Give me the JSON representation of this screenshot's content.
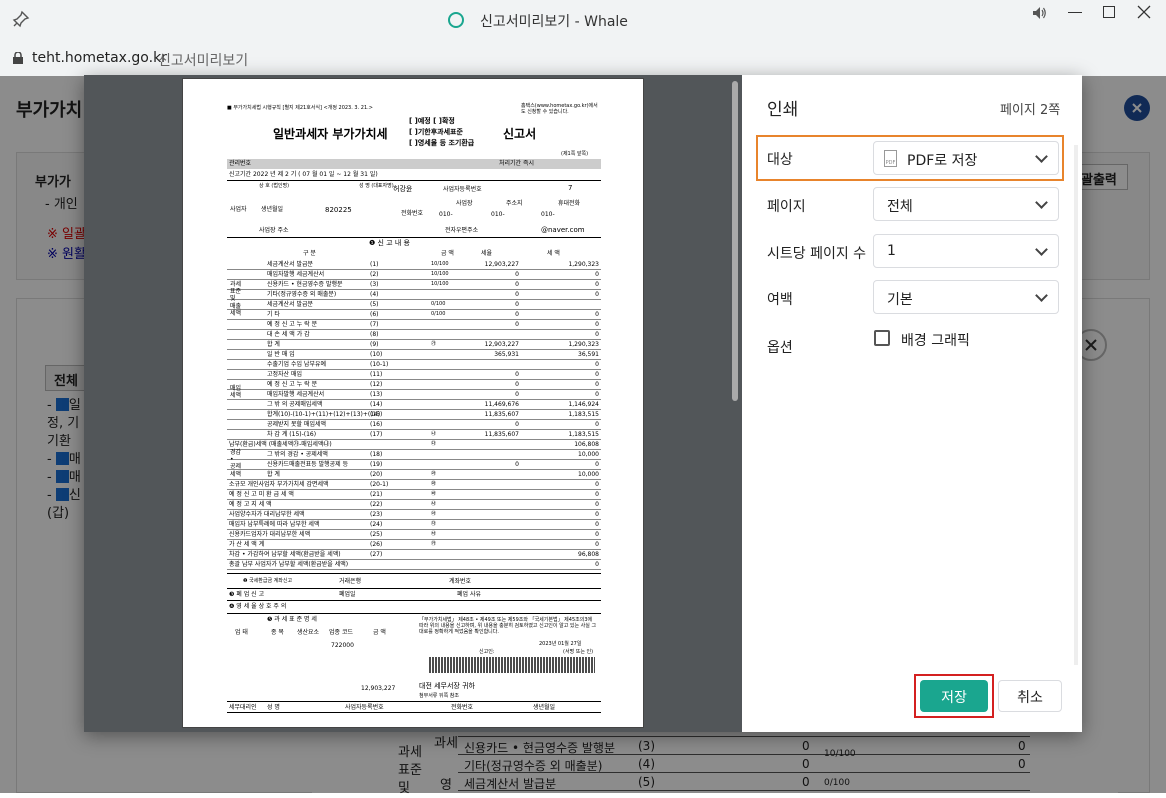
{
  "window": {
    "title": "신고서미리보기 - Whale",
    "url_host": "teht.hometax.go.kr",
    "url_title": "신고서미리보기"
  },
  "background": {
    "heading": "부가가치",
    "notice_title": "부가가",
    "notice_sub": "- 개인",
    "warn1": "※ 일괄",
    "warn2": "※ 원활",
    "print_btn": "괄출력",
    "all_btn": "전체",
    "tree": [
      "일",
      "정, 기",
      "기환",
      "매",
      "매",
      "신",
      "(갑)"
    ],
    "table": {
      "cat1": "과세",
      "cat2": "과세\n표준\n및",
      "cat3": "영",
      "rows": [
        {
          "label": "신용카드 • 현금영수증 발행분",
          "no": "(3)",
          "amount": "0",
          "tax": "0"
        },
        {
          "label": "기타(정규영수증 외 매출분)",
          "no": "(4)",
          "amount": "0",
          "rate": "10/100",
          "tax": "0"
        },
        {
          "label": "세금계산서 발급분",
          "no": "(5)",
          "amount": "0",
          "rate": "0/100",
          "tax": ""
        }
      ]
    }
  },
  "print_panel": {
    "title": "인쇄",
    "page_count": "페이지 2쪽",
    "destination_label": "대상",
    "destination_value": "PDF로 저장",
    "destination_icon_text": "PDF",
    "pages_label": "페이지",
    "pages_value": "전체",
    "sheets_label": "시트당 페이지 수",
    "sheets_value": "1",
    "margin_label": "여백",
    "margin_value": "기본",
    "options_label": "옵션",
    "bg_graphics_label": "배경 그래픽",
    "bg_graphics_checked": false,
    "save_button": "저장",
    "cancel_button": "취소",
    "save_color": "#1aa68f",
    "highlight_orange": "#e8842c",
    "highlight_red": "#d42020"
  },
  "form": {
    "header_left": "■ 부가가치세법 시행규칙 [별지 제21호서식] <개정 2023. 3. 21.>",
    "header_right": "홈택스(www.hometax.go.kr)에서도 신청할 수 있습니다.",
    "title": "일반과세자 부가가치세",
    "title_opts": [
      "[ ]예정 [ ]확정",
      "[ ]기한후과세표준",
      "[ ]영세율 등 조기환급"
    ],
    "title_end": "신고서",
    "page_mark": "(제1쪽 앞쪽)",
    "mgmt_no": "관리번호",
    "processing": "처리기간 즉시",
    "period": "신고기간 2022 년 제 2 기 ( 07 월 01 일 ~ 12 월 31 일)",
    "name_label": "상 호 (법인명)",
    "rep_label": "성 명 (대표자명)",
    "rep_name": "허강윤",
    "biz_no_label": "사업자등록번호",
    "biz_no": "7",
    "taxpayer_label": "사업자",
    "birth_label": "생년월일",
    "birth": "820225",
    "phone_label": "전화번호",
    "phone_cols": [
      "사업장",
      "주소지",
      "휴대전화"
    ],
    "phone_vals": [
      "010-",
      "010-",
      "010-"
    ],
    "addr_label": "사업장 주소",
    "email_label": "전자우편주소",
    "email": "@naver.com",
    "section1": "❶ 신 고 내 용",
    "col_headers": [
      "구 분",
      "금 액",
      "세율",
      "세 액"
    ],
    "rows": [
      {
        "l": "세금계산서 발급분",
        "n": "(1)",
        "a": "12,903,227",
        "r": "10/100",
        "t": "1,290,323"
      },
      {
        "l": "매입자발행 세금계산서",
        "n": "(2)",
        "a": "0",
        "r": "10/100",
        "t": "0"
      },
      {
        "l": "신용카드 • 현금영수증 발행분",
        "n": "(3)",
        "a": "0",
        "r": "10/100",
        "t": "0"
      },
      {
        "l": "기타(정규영수증 외 매출분)",
        "n": "(4)",
        "a": "0",
        "r": "",
        "t": "0"
      },
      {
        "l": "세금계산서 발급분",
        "n": "(5)",
        "a": "0",
        "r": "0/100",
        "t": ""
      },
      {
        "l": "기 타",
        "n": "(6)",
        "a": "0",
        "r": "0/100",
        "t": "0"
      },
      {
        "l": "예 정 신 고 누 락 분",
        "n": "(7)",
        "a": "0",
        "r": "",
        "t": "0"
      },
      {
        "l": "대 손 세 액 가 감",
        "n": "(8)",
        "a": "",
        "r": "",
        "t": "0"
      },
      {
        "l": "합 계",
        "n": "(9)",
        "a": "12,903,227",
        "r": "㉮",
        "t": "1,290,323"
      },
      {
        "l": "일 반 매 입",
        "n": "(10)",
        "a": "365,931",
        "r": "",
        "t": "36,591"
      },
      {
        "l": "수출기업 수입 납부유예",
        "n": "(10-1)",
        "a": "",
        "r": "",
        "t": "0"
      },
      {
        "l": "고정자산 매입",
        "n": "(11)",
        "a": "0",
        "r": "",
        "t": "0"
      },
      {
        "l": "예 정 신 고 누 락 분",
        "n": "(12)",
        "a": "0",
        "r": "",
        "t": "0"
      },
      {
        "l": "매입자발행 세금계산서",
        "n": "(13)",
        "a": "0",
        "r": "",
        "t": "0"
      },
      {
        "l": "그 밖 의 공제매입세액",
        "n": "(14)",
        "a": "11,469,676",
        "r": "",
        "t": "1,146,924"
      },
      {
        "l": "합계(10)-(10-1)+(11)+(12)+(13)+(14)",
        "n": "(15)",
        "a": "11,835,607",
        "r": "",
        "t": "1,183,515"
      },
      {
        "l": "공제받지 못할 매입세액",
        "n": "(16)",
        "a": "0",
        "r": "",
        "t": "0"
      },
      {
        "l": "차 감 계 (15)-(16)",
        "n": "(17)",
        "a": "11,835,607",
        "r": "㉯",
        "t": "1,183,515"
      },
      {
        "l": "납부(환급)세액 (매출세액㉮-매입세액㉯)",
        "n": "",
        "a": "",
        "r": "㉰",
        "t": "106,808"
      },
      {
        "l": "그 밖의 경감 • 공제세액",
        "n": "(18)",
        "a": "",
        "r": "",
        "t": "10,000"
      },
      {
        "l": "신용카드매출전표등 발행공제 등",
        "n": "(19)",
        "a": "0",
        "r": "",
        "t": "0"
      },
      {
        "l": "합 계",
        "n": "(20)",
        "a": "",
        "r": "㉱",
        "t": "10,000"
      },
      {
        "l": "소규모 개인사업자 부가가치세 감면세액",
        "n": "(20-1)",
        "a": "",
        "r": "㉲",
        "t": "0"
      },
      {
        "l": "예 정 신 고 미 환 급 세 액",
        "n": "(21)",
        "a": "",
        "r": "㉳",
        "t": "0"
      },
      {
        "l": "예 정 고 지 세 액",
        "n": "(22)",
        "a": "",
        "r": "㉴",
        "t": "0"
      },
      {
        "l": "사업양수자가 대리납부한 세액",
        "n": "(23)",
        "a": "",
        "r": "㉵",
        "t": "0"
      },
      {
        "l": "매입자 납부특례에 따라 납부한 세액",
        "n": "(24)",
        "a": "",
        "r": "㉶",
        "t": "0"
      },
      {
        "l": "신용카드업자가 대리납부한 세액",
        "n": "(25)",
        "a": "",
        "r": "㉷",
        "t": "0"
      },
      {
        "l": "가 산 세 액 계",
        "n": "(26)",
        "a": "",
        "r": "㉸",
        "t": "0"
      },
      {
        "l": "차감 • 가감하여 납부할 세액(환급받을 세액)",
        "n": "(27)",
        "a": "",
        "r": "",
        "t": "96,808"
      },
      {
        "l": "총괄 납부 사업자가 납부할 세액(환급받을 세액)",
        "n": "",
        "a": "",
        "r": "",
        "t": "0"
      }
    ],
    "group_labels": {
      "sales": "과세\n표준\n및\n매출\n세액",
      "purchase": "매입\n세액",
      "reduction": "경감\n•\n공제\n세액"
    },
    "refund": "❷ 국세환급금 계좌신고",
    "bank": "거래은행",
    "account": "계좌번호",
    "closure": "❸ 폐 업 신 고",
    "closure_date": "폐업일",
    "closure_reason": "폐업 사유",
    "zero_rate": "❹ 영 세 율 상 호 주 의",
    "tax_std": "❺ 과 세 표 준 명 세",
    "tax_std_cols": [
      "업 태",
      "종 목",
      "생산요소",
      "업종 코드",
      "금 액"
    ],
    "industry_code": "722000",
    "std_amount": "12,903,227",
    "declaration": "「부가가치세법」 제48조 • 제49조 또는 제59조와 「국세기본법」 제45조의3에 따라 위의 내용을 신고하며, 위 내용을 충분히 검토하였고 신고인이 알고 있는 사실 그대로를 정확하게 적었음을 확인합니다.",
    "date": "2023년 01월 27일",
    "signer": "신고인:",
    "signer_note": "(서명 또는 인)",
    "office": "대전 세무서장 귀하",
    "attach": "첨부서류 뒤쪽 참조",
    "agent_row": [
      "세무대리인",
      "성 명",
      "사업자등록번호",
      "전화번호",
      "생년월일"
    ]
  }
}
